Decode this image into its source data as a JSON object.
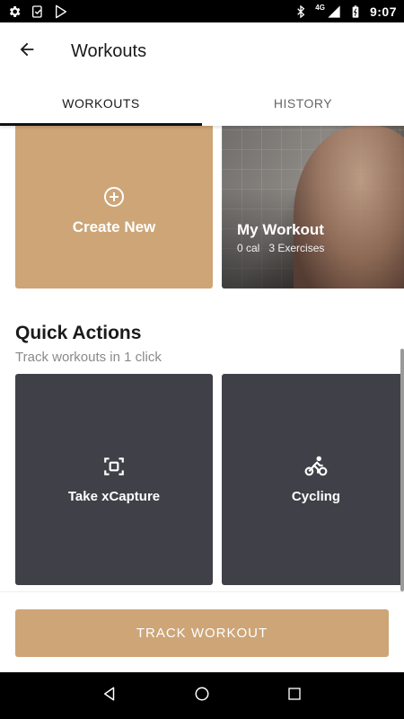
{
  "status_bar": {
    "time": "9:07",
    "network": "4G",
    "icons": [
      "gear-icon",
      "clipboard-check-icon",
      "play-store-icon",
      "bluetooth-icon",
      "signal-icon",
      "battery-icon"
    ]
  },
  "header": {
    "title": "Workouts",
    "back_icon": "arrow-left-icon"
  },
  "tabs": [
    {
      "label": "WORKOUTS",
      "active": true
    },
    {
      "label": "HISTORY",
      "active": false
    }
  ],
  "workouts": {
    "create": {
      "label": "Create New",
      "icon": "plus-circle-icon"
    },
    "items": [
      {
        "title": "My Workout",
        "calories": "0 cal",
        "exercises": "3 Exercises"
      }
    ]
  },
  "quick_actions": {
    "title": "Quick Actions",
    "subtitle": "Track workouts in 1 click",
    "items": [
      {
        "label": "Take xCapture",
        "icon": "capture-icon"
      },
      {
        "label": "Cycling",
        "icon": "cycling-icon"
      }
    ]
  },
  "track_button": {
    "label": "TRACK WORKOUT"
  },
  "colors": {
    "accent": "#cda577",
    "action_card": "#404048",
    "text_dark": "#1a1a1a",
    "text_muted": "#8a8a8a"
  },
  "nav_bar": {
    "icons": [
      "back-triangle-icon",
      "home-circle-icon",
      "recents-square-icon"
    ]
  }
}
